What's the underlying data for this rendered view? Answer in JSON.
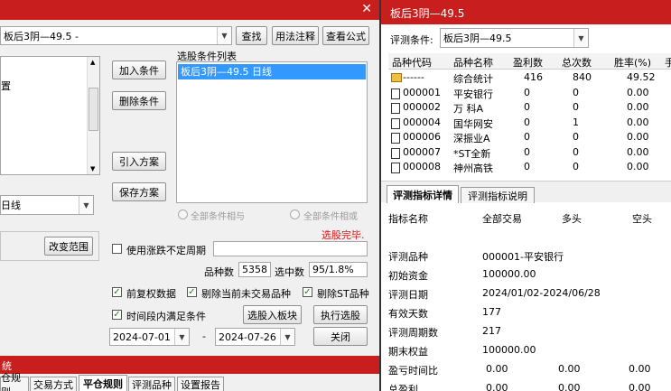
{
  "left_window": {
    "formula_select": "板后3阴—49.5  -",
    "btn_find": "查找",
    "btn_usage": "用法注释",
    "btn_view_formula": "查看公式",
    "list_title": "选股条件列表",
    "list_item": "板后3阴—49.5  日线",
    "btn_add": "加入条件",
    "btn_delete": "删除条件",
    "btn_import": "引入方案",
    "btn_save": "保存方案",
    "left_text": "置",
    "period_select": "日线",
    "radio_and": "全部条件相与",
    "radio_or": "全部条件相或",
    "status": "选股完毕.",
    "btn_change_range": "改变范围",
    "chk_uncertain_period": "使用涨跌不定周期",
    "stock_count_label": "品种数",
    "stock_count": "5358",
    "selected_label": "选中数",
    "selected_value": "95/1.8%",
    "chk_fq": "前复权数据",
    "chk_del_untraded": "剔除当前未交易品种",
    "chk_del_st": "剔除ST品种",
    "chk_time_range": "时间段内满足条件",
    "btn_to_block": "选股入板块",
    "btn_execute": "执行选股",
    "date_start": "2024-07-01",
    "date_sep": "-",
    "date_end": "2024-07-26",
    "btn_close": "关闭"
  },
  "bottom_window": {
    "title": "统",
    "tabs": [
      "仓规则",
      "交易方式",
      "平仓规则",
      "评测品种",
      "设置报告"
    ]
  },
  "right_window": {
    "title": "板后3阴—49.5",
    "condition_label": "评测条件:",
    "condition_value": "板后3阴—49.5",
    "columns": [
      "品种代码",
      "品种名称",
      "盈利数",
      "总次数",
      "胜率(%)",
      "手"
    ],
    "rows": [
      {
        "code": "------",
        "name": "综合统计",
        "profit": "416",
        "total": "840",
        "rate": "49.52"
      },
      {
        "code": "000001",
        "name": "平安银行",
        "profit": "0",
        "total": "0",
        "rate": "0.00"
      },
      {
        "code": "000002",
        "name": "万 科A",
        "profit": "0",
        "total": "0",
        "rate": "0.00"
      },
      {
        "code": "000004",
        "name": "国华网安",
        "profit": "0",
        "total": "1",
        "rate": "0.00"
      },
      {
        "code": "000006",
        "name": "深振业A",
        "profit": "0",
        "total": "0",
        "rate": "0.00"
      },
      {
        "code": "000007",
        "name": "*ST全新",
        "profit": "0",
        "total": "0",
        "rate": "0.00"
      },
      {
        "code": "000008",
        "name": "神州高铁",
        "profit": "0",
        "total": "0",
        "rate": "0.00"
      }
    ],
    "tab_detail": "评测指标详情",
    "tab_desc": "评测指标说明",
    "detail_headers": [
      "指标名称",
      "全部交易",
      "多头",
      "空头"
    ],
    "details": [
      {
        "name": "评测品种",
        "all": "000001-平安银行",
        "long": "",
        "short": ""
      },
      {
        "name": "初始资金",
        "all": "100000.00",
        "long": "",
        "short": ""
      },
      {
        "name": "评测日期",
        "all": "2024/01/02-2024/06/28",
        "long": "",
        "short": ""
      },
      {
        "name": "有效天数",
        "all": "177",
        "long": "",
        "short": ""
      },
      {
        "name": "评测周期数",
        "all": "217",
        "long": "",
        "short": ""
      },
      {
        "name": "期末权益",
        "all": "100000.00",
        "long": "",
        "short": ""
      },
      {
        "name": "盈亏时间比",
        "all": "0.00",
        "long": "0.00",
        "short": "0.00"
      },
      {
        "name": "总盈利",
        "all": "0.00",
        "long": "0.00",
        "short": "0.00"
      }
    ]
  },
  "colors": {
    "title_red": "#c81e1e",
    "list_select": "#3399ff",
    "status_red": "#e01010"
  }
}
